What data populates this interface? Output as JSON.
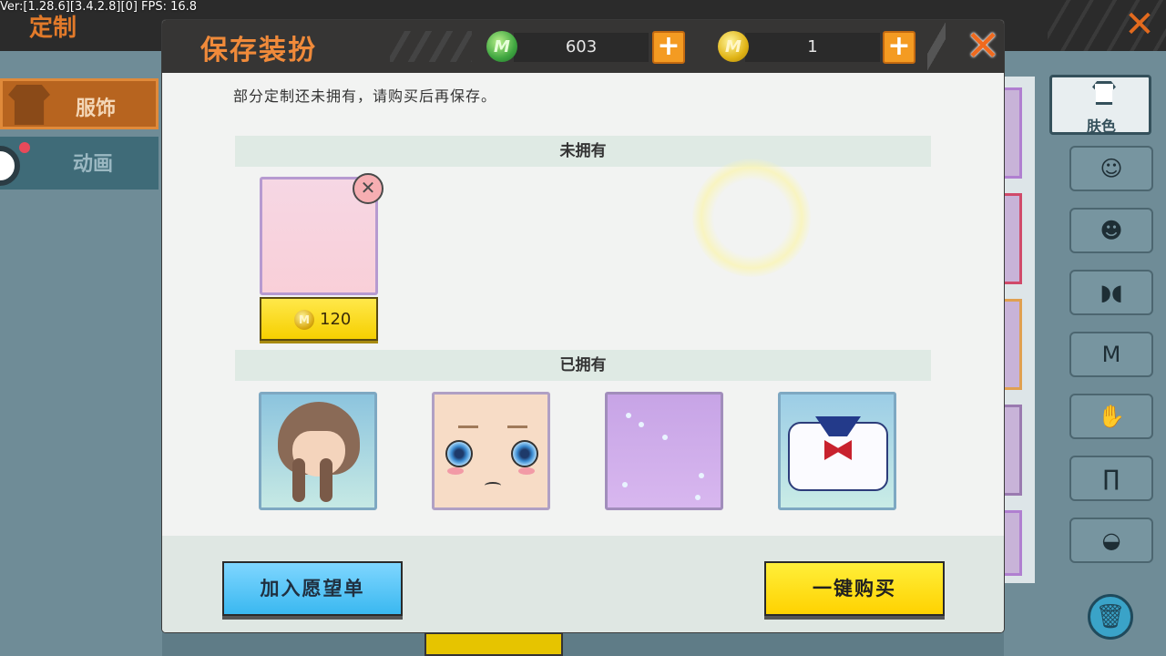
{
  "debug": {
    "text": "Ver:[1.28.6][3.4.2.8][0] FPS: 16.8"
  },
  "background": {
    "title": "定制",
    "close_icon": "close-icon",
    "tabs": [
      {
        "label": "服饰",
        "icon": "shirt-icon"
      },
      {
        "label": "动画",
        "icon": "animation-icon"
      }
    ],
    "skin_tab_label": "肤色",
    "categories": [
      "hair-icon",
      "face-icon",
      "mask-icon",
      "shirt-icon",
      "gloves-icon",
      "pants-icon",
      "shoes-icon"
    ],
    "trash_icon": "trash-icon"
  },
  "dialog": {
    "title": "保存装扮",
    "gems": {
      "value": "603",
      "icon": "green-gem-icon"
    },
    "coins": {
      "value": "1",
      "icon": "gold-coin-icon"
    },
    "message": "部分定制还未拥有，请购买后再保存。",
    "unowned_header": "未拥有",
    "owned_header": "已拥有",
    "unowned_items": [
      {
        "name": "pink background",
        "price": "120"
      }
    ],
    "owned_items": [
      "hair",
      "face",
      "background",
      "top"
    ],
    "wishlist_label": "加入愿望单",
    "buy_all_label": "一键购买"
  },
  "colors": {
    "accent_orange": "#f08a3a",
    "header_dark": "#363534",
    "buy_yellow": "#ffd200",
    "wishlist_blue": "#3ab8f0",
    "section_bar": "#dfeae4"
  }
}
